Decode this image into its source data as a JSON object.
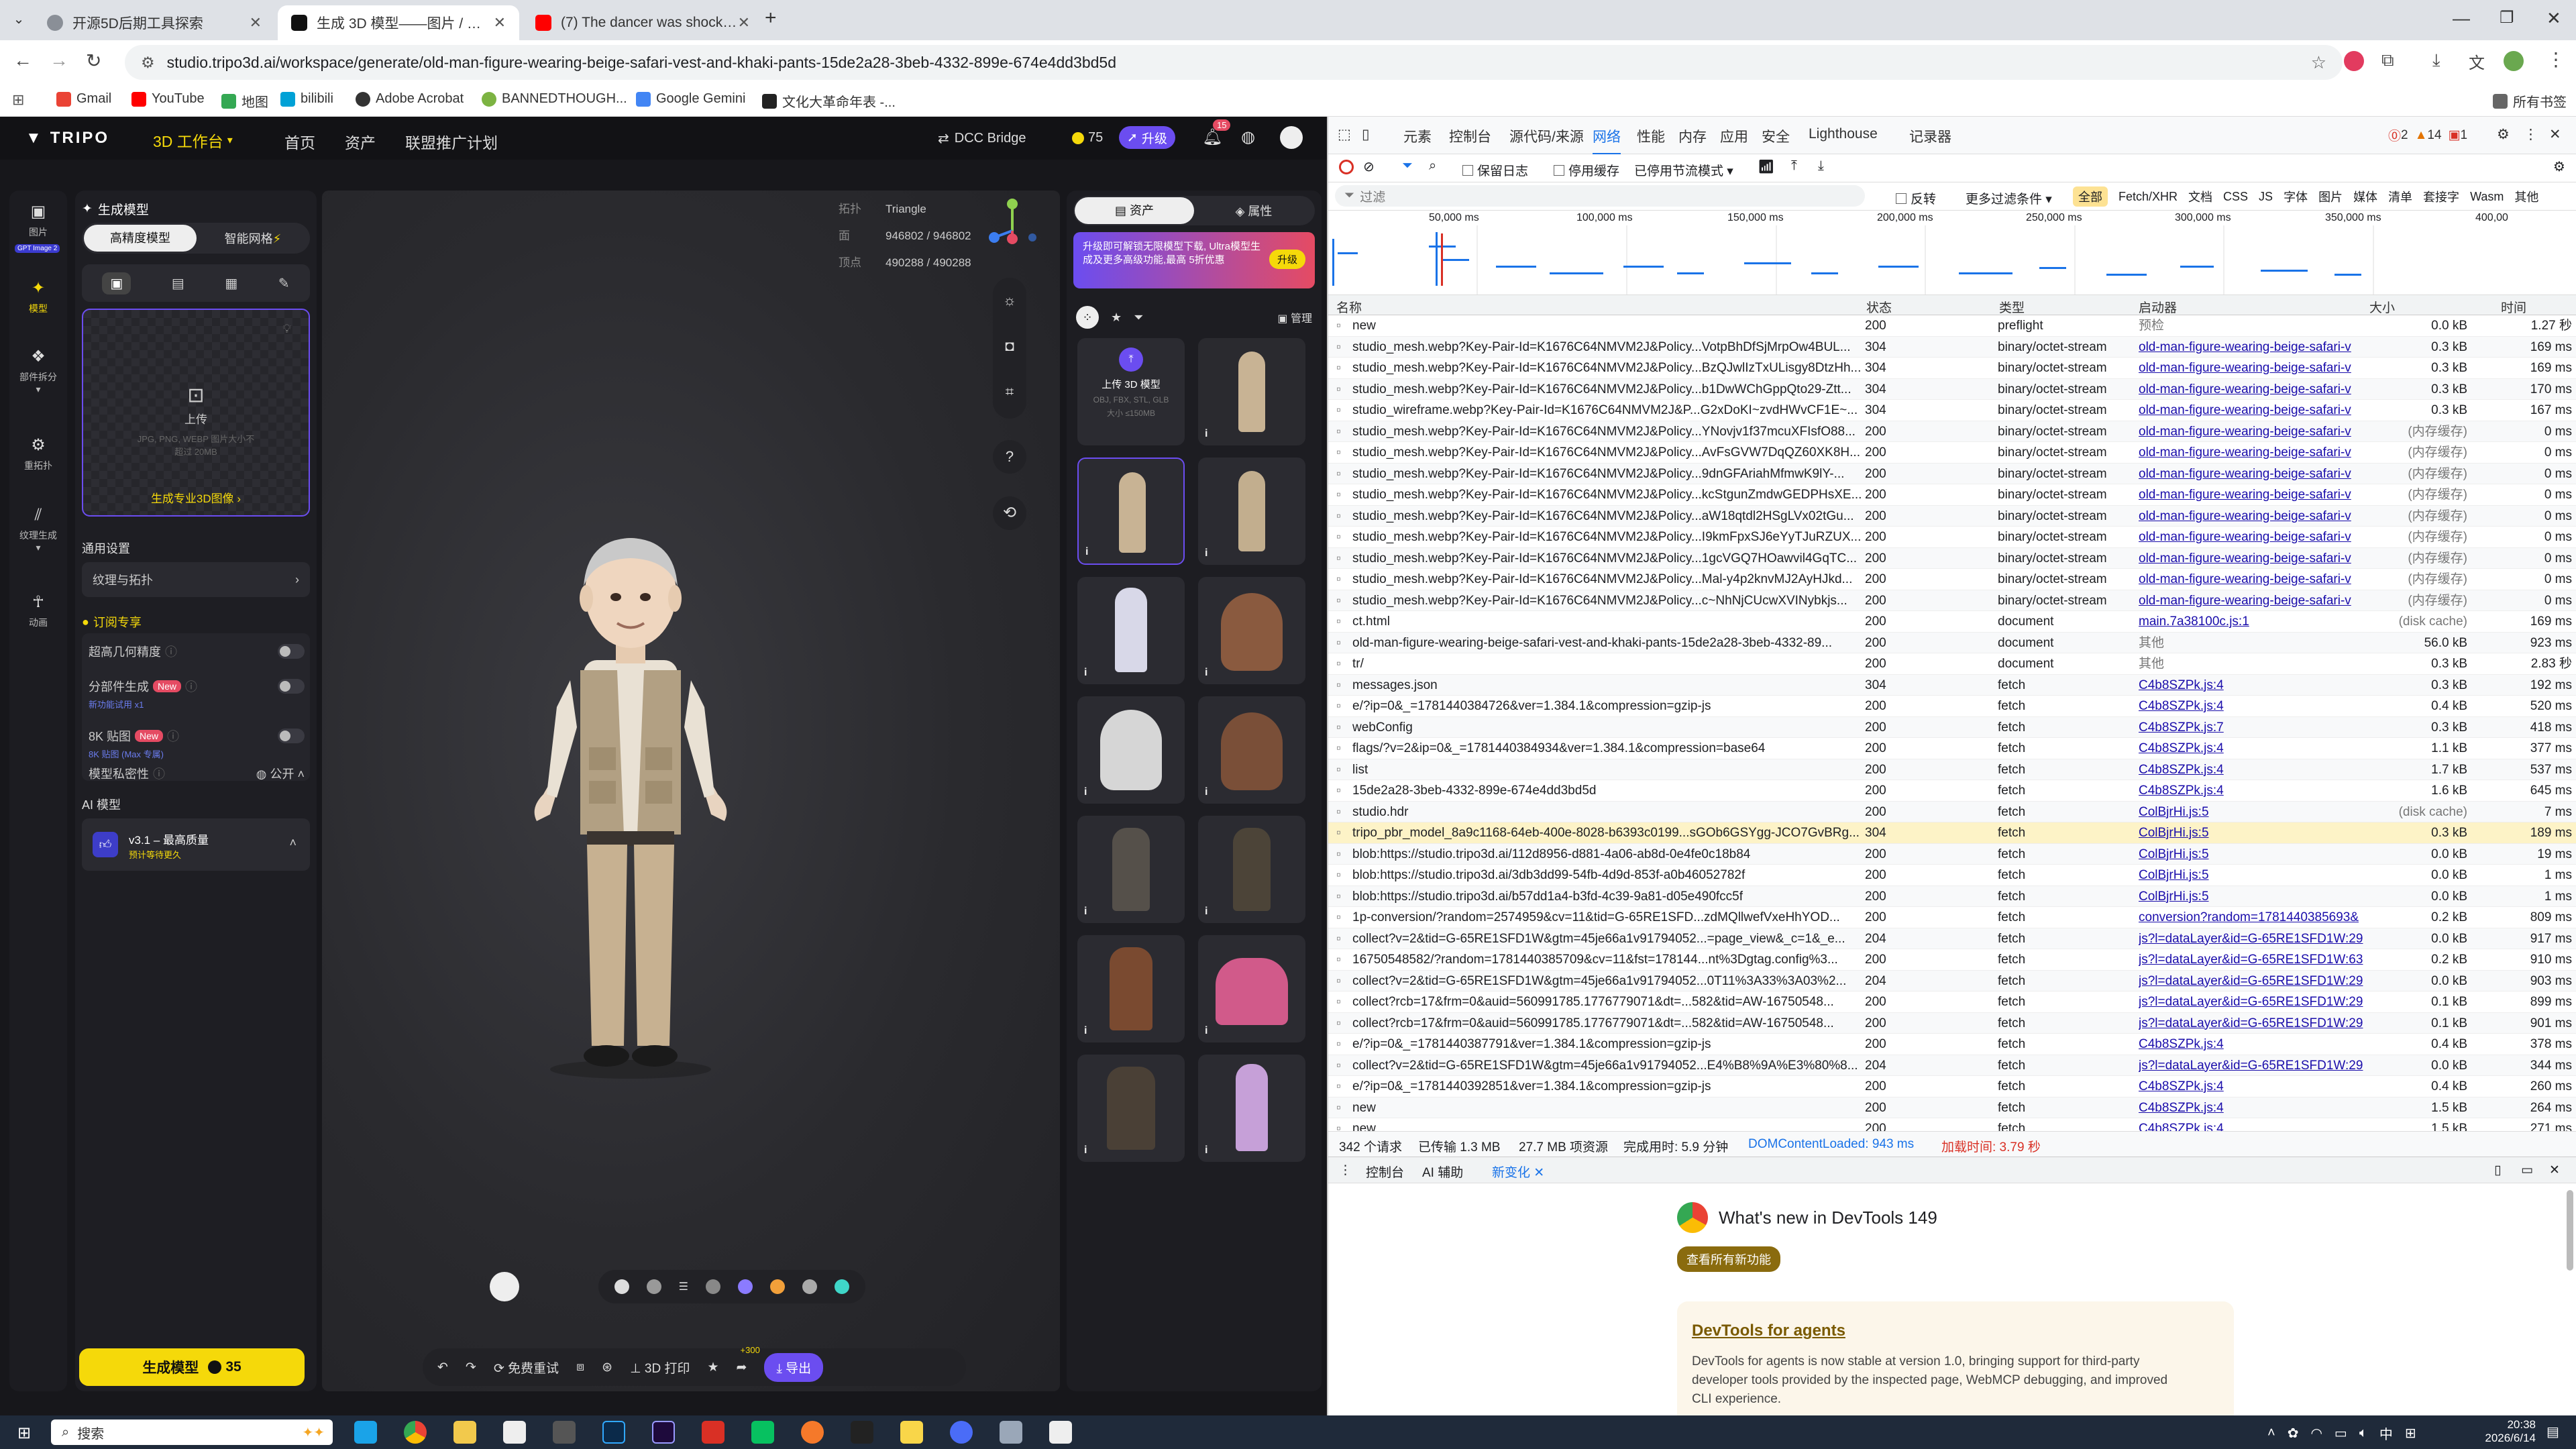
{
  "browser": {
    "tabs": [
      {
        "title": "开源5D后期工具探索",
        "color": "#5f6368"
      },
      {
        "title": "生成 3D 模型——图片 / 文本转3D",
        "color": "#111111"
      },
      {
        "title": "(7) The dancer was shocked after",
        "color": "#ff0000"
      }
    ],
    "url": "studio.tripo3d.ai/workspace/generate/old-man-figure-wearing-beige-safari-vest-and-khaki-pants-15de2a28-3beb-4332-899e-674e4dd3bd5d",
    "bookmarks": [
      "Gmail",
      "YouTube",
      "地图",
      "bilibili",
      "Adobe Acrobat",
      "BANNEDTHOUGH...",
      "Google Gemini",
      "文化大革命年表 -..."
    ],
    "all_bookmarks": "所有书签"
  },
  "tripo": {
    "logo": "TRIPO",
    "workspace": "3D 工作台",
    "nav": [
      "首页",
      "资产",
      "联盟推广计划"
    ],
    "dcc": "DCC Bridge",
    "credits": "75",
    "upgrade": "升级",
    "notifications": "15",
    "left_icons": [
      {
        "label": "图片",
        "icon": "image-icon"
      },
      {
        "label": "模型",
        "icon": "model-icon"
      },
      {
        "label": "部件拆分",
        "icon": "parts-icon"
      },
      {
        "label": "重拓扑",
        "icon": "retopo-icon"
      },
      {
        "label": "纹理生成",
        "icon": "texture-icon"
      },
      {
        "label": "动画",
        "icon": "animation-icon"
      }
    ],
    "gpt_badge": "GPT Image 2",
    "panel": {
      "title": "生成模型",
      "mode_hd": "高精度模型",
      "mode_smart": "智能网格",
      "upload_label": "上传",
      "upload_hint": "JPG, PNG, WEBP 图片大小不超过 20MB",
      "pro_link": "生成专业3D图像",
      "general_settings": "通用设置",
      "texture_topology": "纹理与拓扑",
      "sub_exclusive": "订阅专享",
      "ultra_geometry": "超高几何精度",
      "parts_gen": "分部件生成",
      "parts_hint": "新功能试用 x1",
      "eightk": "8K 贴图",
      "eightk_hint": "8K 贴图 (Max 专属)",
      "new_badge": "New",
      "privacy": "模型私密性",
      "privacy_value": "公开",
      "ai_model": "AI 模型",
      "ai_version": "v3.1 – 最高质量",
      "ai_hint": "预计等待更久",
      "generate": "生成模型",
      "generate_cost": "35"
    },
    "viewport": {
      "topology_label": "拓扑",
      "topology_value": "Triangle",
      "face_label": "面",
      "face_value": "946802 / 946802",
      "vertex_label": "顶点",
      "vertex_value": "490288 / 490288",
      "help": "?",
      "toolbar": [
        "免费重试",
        "3D 打印",
        "导出"
      ],
      "plus300": "+300"
    },
    "assets": {
      "tab_assets": "资产",
      "tab_properties": "属性",
      "promo": "升级即可解锁无限模型下载, Ultra模型生成及更多高级功能,最高 5折优惠",
      "promo_btn": "升级",
      "manage": "管理",
      "upload_model": "上传 3D 模型",
      "upload_formats": "OBJ, FBX, STL, GLB",
      "upload_size": "大小 ≤150MB"
    },
    "colors": {
      "accent": "#f5d90a",
      "purple": "#6b4df0",
      "pink": "#e54b63"
    }
  },
  "devtools": {
    "tabs": [
      "元素",
      "控制台",
      "源代码/来源",
      "网络",
      "性能",
      "内存",
      "应用",
      "安全",
      "Lighthouse",
      "记录器"
    ],
    "errors": "2",
    "warnings": "14",
    "issues": "1",
    "preserve_log": "保留日志",
    "disable_cache": "停用缓存",
    "throttle": "已停用节流模式",
    "filter_placeholder": "过滤",
    "invert": "反转",
    "more_filters": "更多过滤条件",
    "type_filters": [
      "全部",
      "Fetch/XHR",
      "文档",
      "CSS",
      "JS",
      "字体",
      "图片",
      "媒体",
      "清单",
      "套接字",
      "Wasm",
      "其他"
    ],
    "timeline_ticks": [
      "50,000 ms",
      "100,000 ms",
      "150,000 ms",
      "200,000 ms",
      "250,000 ms",
      "300,000 ms",
      "350,000 ms",
      "400,00"
    ],
    "columns": [
      "名称",
      "状态",
      "类型",
      "启动器",
      "大小",
      "时间"
    ],
    "requests": [
      [
        "new",
        "200",
        "preflight",
        "预检",
        "0.0 kB",
        "1.27 秒"
      ],
      [
        "studio_mesh.webp?Key-Pair-Id=K1676C64NMVM2J&Policy...VotpBhDfSjMrpOw4BUL...",
        "304",
        "binary/octet-stream",
        "old-man-figure-wearing-beige-safari-v",
        "0.3 kB",
        "169 ms"
      ],
      [
        "studio_mesh.webp?Key-Pair-Id=K1676C64NMVM2J&Policy...BzQJwlIzTxULisgy8DtzHh...",
        "304",
        "binary/octet-stream",
        "old-man-figure-wearing-beige-safari-v",
        "0.3 kB",
        "169 ms"
      ],
      [
        "studio_mesh.webp?Key-Pair-Id=K1676C64NMVM2J&Policy...b1DwWChGppQto29-Ztt...",
        "304",
        "binary/octet-stream",
        "old-man-figure-wearing-beige-safari-v",
        "0.3 kB",
        "170 ms"
      ],
      [
        "studio_wireframe.webp?Key-Pair-Id=K1676C64NMVM2J&P...G2xDoKI~zvdHWvCF1E~...",
        "304",
        "binary/octet-stream",
        "old-man-figure-wearing-beige-safari-v",
        "0.3 kB",
        "167 ms"
      ],
      [
        "studio_mesh.webp?Key-Pair-Id=K1676C64NMVM2J&Policy...YNovjv1f37mcuXFIsfO88...",
        "200",
        "binary/octet-stream",
        "old-man-figure-wearing-beige-safari-v",
        "(内存缓存)",
        "0 ms"
      ],
      [
        "studio_mesh.webp?Key-Pair-Id=K1676C64NMVM2J&Policy...AvFsGVW7DqQZ60XK8H...",
        "200",
        "binary/octet-stream",
        "old-man-figure-wearing-beige-safari-v",
        "(内存缓存)",
        "0 ms"
      ],
      [
        "studio_mesh.webp?Key-Pair-Id=K1676C64NMVM2J&Policy...9dnGFAriahMfmwK9lY-...",
        "200",
        "binary/octet-stream",
        "old-man-figure-wearing-beige-safari-v",
        "(内存缓存)",
        "0 ms"
      ],
      [
        "studio_mesh.webp?Key-Pair-Id=K1676C64NMVM2J&Policy...kcStgunZmdwGEDPHsXE...",
        "200",
        "binary/octet-stream",
        "old-man-figure-wearing-beige-safari-v",
        "(内存缓存)",
        "0 ms"
      ],
      [
        "studio_mesh.webp?Key-Pair-Id=K1676C64NMVM2J&Policy...aW18qtdl2HSgLVx02tGu...",
        "200",
        "binary/octet-stream",
        "old-man-figure-wearing-beige-safari-v",
        "(内存缓存)",
        "0 ms"
      ],
      [
        "studio_mesh.webp?Key-Pair-Id=K1676C64NMVM2J&Policy...I9kmFpxSJ6eYyTJuRZUX...",
        "200",
        "binary/octet-stream",
        "old-man-figure-wearing-beige-safari-v",
        "(内存缓存)",
        "0 ms"
      ],
      [
        "studio_mesh.webp?Key-Pair-Id=K1676C64NMVM2J&Policy...1gcVGQ7HOawvil4GqTC...",
        "200",
        "binary/octet-stream",
        "old-man-figure-wearing-beige-safari-v",
        "(内存缓存)",
        "0 ms"
      ],
      [
        "studio_mesh.webp?Key-Pair-Id=K1676C64NMVM2J&Policy...Mal-y4p2knvMJ2AyHJkd...",
        "200",
        "binary/octet-stream",
        "old-man-figure-wearing-beige-safari-v",
        "(内存缓存)",
        "0 ms"
      ],
      [
        "studio_mesh.webp?Key-Pair-Id=K1676C64NMVM2J&Policy...c~NhNjCUcwXVINybkjs...",
        "200",
        "binary/octet-stream",
        "old-man-figure-wearing-beige-safari-v",
        "(内存缓存)",
        "0 ms"
      ],
      [
        "ct.html",
        "200",
        "document",
        "main.7a38100c.js:1",
        "(disk cache)",
        "169 ms"
      ],
      [
        "old-man-figure-wearing-beige-safari-vest-and-khaki-pants-15de2a28-3beb-4332-89...",
        "200",
        "document",
        "其他",
        "56.0 kB",
        "923 ms"
      ],
      [
        "tr/",
        "200",
        "document",
        "其他",
        "0.3 kB",
        "2.83 秒"
      ],
      [
        "messages.json",
        "304",
        "fetch",
        "C4b8SZPk.js:4",
        "0.3 kB",
        "192 ms"
      ],
      [
        "e/?ip=0&_=1781440384726&ver=1.384.1&compression=gzip-js",
        "200",
        "fetch",
        "C4b8SZPk.js:4",
        "0.4 kB",
        "520 ms"
      ],
      [
        "webConfig",
        "200",
        "fetch",
        "C4b8SZPk.js:7",
        "0.3 kB",
        "418 ms"
      ],
      [
        "flags/?v=2&ip=0&_=1781440384934&ver=1.384.1&compression=base64",
        "200",
        "fetch",
        "C4b8SZPk.js:4",
        "1.1 kB",
        "377 ms"
      ],
      [
        "list",
        "200",
        "fetch",
        "C4b8SZPk.js:4",
        "1.7 kB",
        "537 ms"
      ],
      [
        "15de2a28-3beb-4332-899e-674e4dd3bd5d",
        "200",
        "fetch",
        "C4b8SZPk.js:4",
        "1.6 kB",
        "645 ms"
      ],
      [
        "studio.hdr",
        "200",
        "fetch",
        "ColBjrHi.js:5",
        "(disk cache)",
        "7 ms"
      ],
      [
        "tripo_pbr_model_8a9c1168-64eb-400e-8028-b6393c0199...sGOb6GSYgg-JCO7GvBRg...",
        "304",
        "fetch",
        "ColBjrHi.js:5",
        "0.3 kB",
        "189 ms"
      ],
      [
        "blob:https://studio.tripo3d.ai/112d8956-d881-4a06-ab8d-0e4fe0c18b84",
        "200",
        "fetch",
        "ColBjrHi.js:5",
        "0.0 kB",
        "19 ms"
      ],
      [
        "blob:https://studio.tripo3d.ai/3db3dd99-54fb-4d9d-853f-a0b46052782f",
        "200",
        "fetch",
        "ColBjrHi.js:5",
        "0.0 kB",
        "1 ms"
      ],
      [
        "blob:https://studio.tripo3d.ai/b57dd1a4-b3fd-4c39-9a81-d05e490fcc5f",
        "200",
        "fetch",
        "ColBjrHi.js:5",
        "0.0 kB",
        "1 ms"
      ],
      [
        "1p-conversion/?random=2574959&cv=11&tid=G-65RE1SFD...zdMQllwefVxeHhYOD...",
        "200",
        "fetch",
        "conversion?random=1781440385693&",
        "0.2 kB",
        "809 ms"
      ],
      [
        "collect?v=2&tid=G-65RE1SFD1W&gtm=45je66a1v91794052...=page_view&_c=1&_e...",
        "204",
        "fetch",
        "js?l=dataLayer&id=G-65RE1SFD1W:29",
        "0.0 kB",
        "917 ms"
      ],
      [
        "16750548582/?random=1781440385709&cv=11&fst=178144...nt%3Dgtag.config%3...",
        "200",
        "fetch",
        "js?l=dataLayer&id=G-65RE1SFD1W:63",
        "0.2 kB",
        "910 ms"
      ],
      [
        "collect?v=2&tid=G-65RE1SFD1W&gtm=45je66a1v91794052...0T11%3A33%3A03%2...",
        "204",
        "fetch",
        "js?l=dataLayer&id=G-65RE1SFD1W:29",
        "0.0 kB",
        "903 ms"
      ],
      [
        "collect?rcb=17&frm=0&auid=560991785.1776779071&dt=...582&tid=AW-16750548...",
        "200",
        "fetch",
        "js?l=dataLayer&id=G-65RE1SFD1W:29",
        "0.1 kB",
        "899 ms"
      ],
      [
        "collect?rcb=17&frm=0&auid=560991785.1776779071&dt=...582&tid=AW-16750548...",
        "200",
        "fetch",
        "js?l=dataLayer&id=G-65RE1SFD1W:29",
        "0.1 kB",
        "901 ms"
      ],
      [
        "e/?ip=0&_=1781440387791&ver=1.384.1&compression=gzip-js",
        "200",
        "fetch",
        "C4b8SZPk.js:4",
        "0.4 kB",
        "378 ms"
      ],
      [
        "collect?v=2&tid=G-65RE1SFD1W&gtm=45je66a1v91794052...E4%B8%9A%E3%80%8...",
        "204",
        "fetch",
        "js?l=dataLayer&id=G-65RE1SFD1W:29",
        "0.0 kB",
        "344 ms"
      ],
      [
        "e/?ip=0&_=1781440392851&ver=1.384.1&compression=gzip-js",
        "200",
        "fetch",
        "C4b8SZPk.js:4",
        "0.4 kB",
        "260 ms"
      ],
      [
        "new",
        "200",
        "fetch",
        "C4b8SZPk.js:4",
        "1.5 kB",
        "264 ms"
      ],
      [
        "new",
        "200",
        "fetch",
        "C4b8SZPk.js:4",
        "1.5 kB",
        "271 ms"
      ]
    ],
    "status_summary": {
      "requests": "342 个请求",
      "transferred": "已传输 1.3 MB",
      "resources": "27.7 MB 项资源",
      "finish": "完成用时: 5.9 分钟",
      "dcl": "DOMContentLoaded: 943 ms",
      "load": "加载时间: 3.79 秒"
    },
    "drawer_tabs": [
      "控制台",
      "AI 辅助",
      "新变化"
    ],
    "whatsnew_title": "What's new in DevTools 149",
    "whatsnew_btn": "查看所有新功能",
    "card_title": "DevTools for agents",
    "card_text": "DevTools for agents is now stable at version 1.0, bringing support for third-party developer tools provided by the inspected page, WebMCP debugging, and improved CLI experience."
  },
  "taskbar": {
    "search": "搜索",
    "time": "20:38",
    "date": "2026/6/14",
    "ime": "中"
  }
}
